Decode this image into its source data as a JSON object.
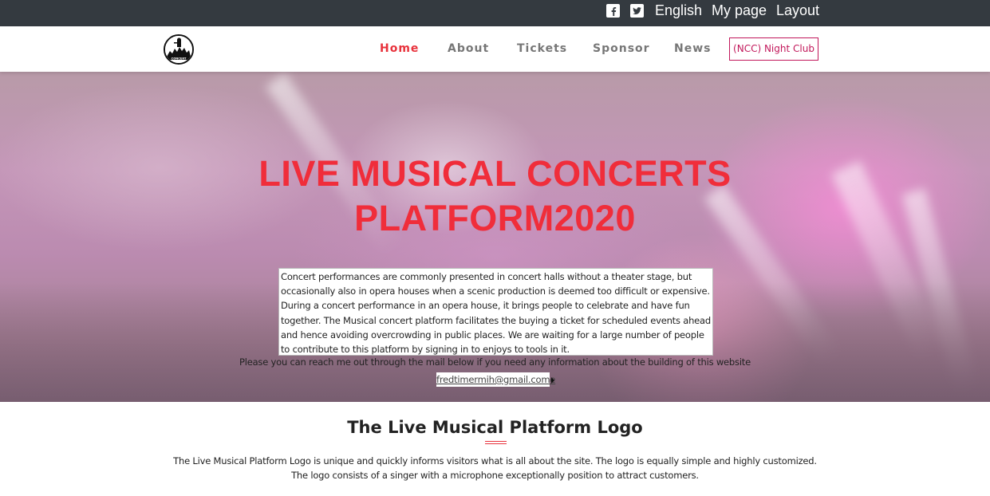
{
  "topbar": {
    "icons": [
      "facebook-icon",
      "twitter-icon"
    ],
    "language": "English",
    "my_page": "My page",
    "layout": "Layout"
  },
  "navbar": {
    "logo_text": "CONCERT",
    "items": [
      {
        "label": "Home",
        "active": true
      },
      {
        "label": "About",
        "active": false
      },
      {
        "label": "Tickets",
        "active": false
      },
      {
        "label": "Sponsor",
        "active": false
      },
      {
        "label": "News",
        "active": false
      }
    ],
    "club_button": "(NCC) Night Club"
  },
  "hero": {
    "title_line1": "LIVE MUSICAL CONCERTS",
    "title_line2": "PLATFORM2020",
    "description": "Concert performances are commonly presented in concert halls without a theater stage, but occasionally also in opera houses when a scenic production is deemed too difficult or expensive. During a concert performance in an opera house, it brings people to celebrate and have fun together. The Musical concert platform facilitates the buying a ticket for scheduled events ahead and hence avoiding overcrowding in public places. We are waiting for a large number of people to contribute to this platform by signing in to enjoys to tools in it.",
    "contact_text": "Please you can reach me out through the mail below if you need any information about the building of this website",
    "email": "fredtimermih@gmail.come"
  },
  "logo_section": {
    "title": "The Live Musical Platform Logo",
    "line1": "The Live Musical Platform Logo is unique and quickly informs visitors what is all about the site. The logo is equally simple and highly customized.",
    "line2": "The logo consists of a singer with a microphone exceptionally position to attract customers."
  },
  "colors": {
    "topbar_bg": "#343a40",
    "accent_red": "#e8323c",
    "title_red": "#f02d3a",
    "club_pink": "#c2185b"
  }
}
